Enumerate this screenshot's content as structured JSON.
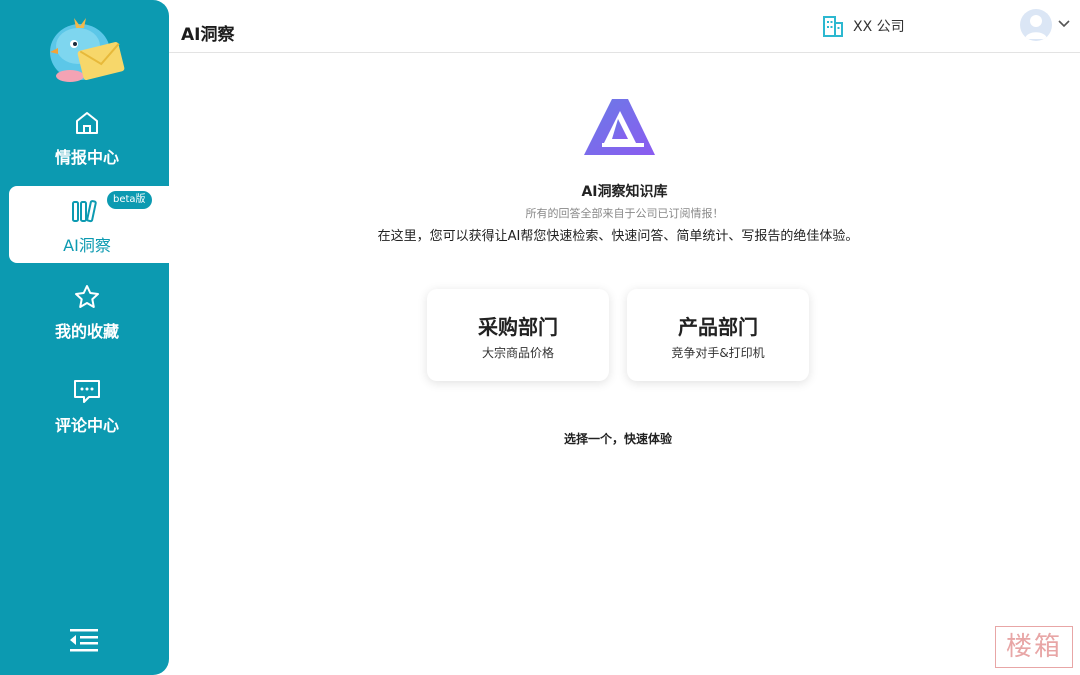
{
  "sidebar": {
    "items": [
      {
        "label": "情报中心",
        "icon": "home-icon"
      },
      {
        "label": "AI洞察",
        "icon": "books-icon",
        "badge": "beta版",
        "active": true
      },
      {
        "label": "我的收藏",
        "icon": "star-icon"
      },
      {
        "label": "评论中心",
        "icon": "comment-icon"
      }
    ],
    "collapse_icon": "collapse-menu-icon"
  },
  "header": {
    "title": "AI洞察",
    "company": "XX 公司",
    "company_icon": "building-icon",
    "user_icon": "avatar-icon"
  },
  "main": {
    "kb_title": "AI洞察知识库",
    "kb_subtitle": "所有的回答全部来自于公司已订阅情报！",
    "kb_description": "在这里，您可以获得让AI帮您快速检索、快速问答、简单统计、写报告的绝佳体验。",
    "cards": [
      {
        "title": "采购部门",
        "subtitle": "大宗商品价格"
      },
      {
        "title": "产品部门",
        "subtitle": "竞争对手&打印机"
      }
    ],
    "hint": "选择一个，快速体验"
  },
  "watermark": "楼箱",
  "colors": {
    "sidebar_bg": "#0c9ab1",
    "accent": "#0c9ab1",
    "logo_gradient_start": "#6a7be6",
    "logo_gradient_end": "#8b5cf0"
  }
}
